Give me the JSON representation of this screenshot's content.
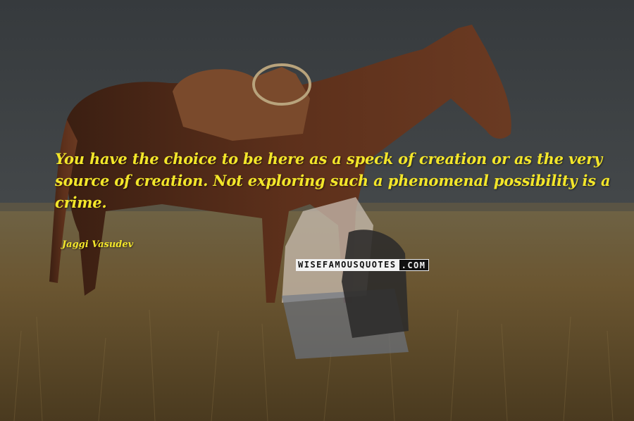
{
  "quote": {
    "lines": [
      "You have the choice to be here as a speck of creation or as the very",
      "source of creation. Not exploring such a phenomenal possibility is a",
      "crime."
    ],
    "author": "Jaggi Vasudev"
  },
  "watermark": {
    "main": "WISEFAMOUSQUOTES",
    "tld": ".COM"
  },
  "colors": {
    "sky": "#3b3f42",
    "text": "#f3e62a",
    "grass": "#6b5a34",
    "horse": "#5a2f1c"
  }
}
